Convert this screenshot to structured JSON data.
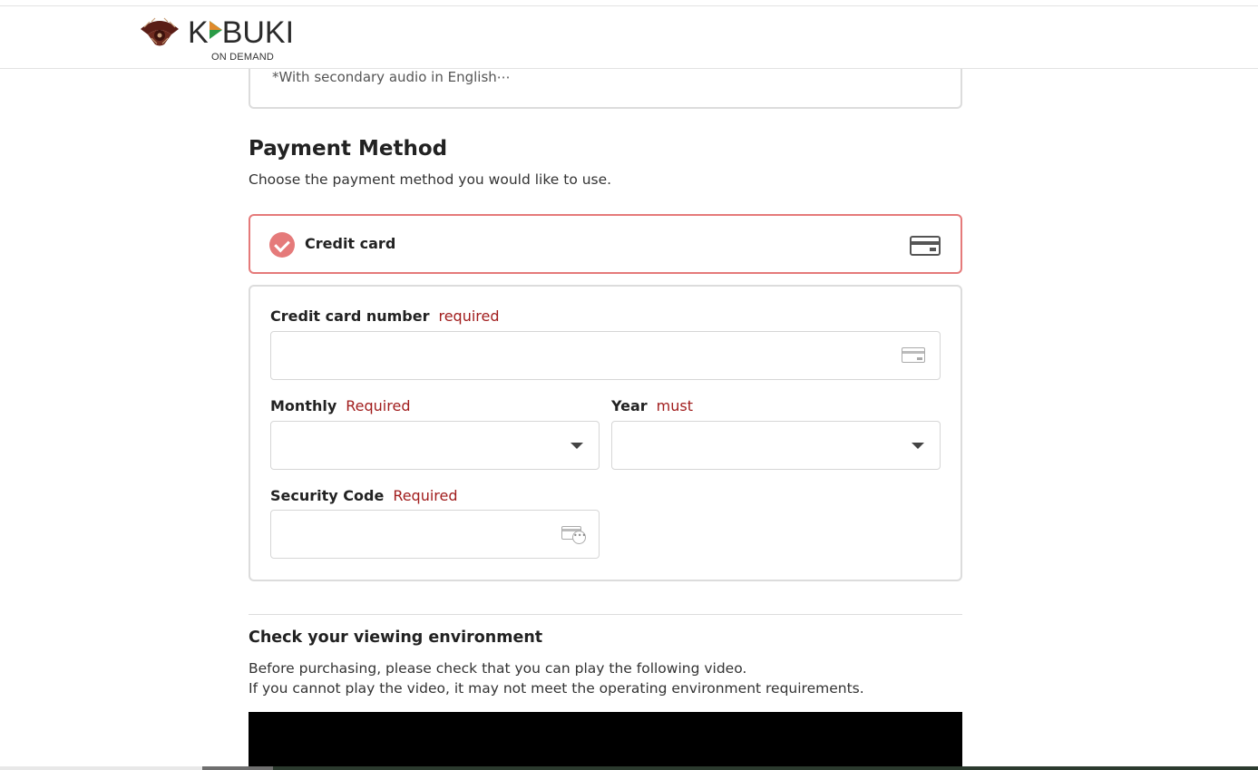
{
  "header": {
    "logo_text_1": "K",
    "logo_text_2": "BUKI",
    "logo_sub": "ON DEMAND"
  },
  "previous_section": {
    "note": "*With secondary audio in English⋯"
  },
  "payment": {
    "title": "Payment Method",
    "description": "Choose the payment method you would like to use.",
    "option_label": "Credit card",
    "accent_color": "#e57a7a"
  },
  "form": {
    "card_number_label": "Credit card number",
    "card_number_req": "required",
    "card_number_value": "",
    "month_label": "Monthly",
    "month_req": "Required",
    "month_value": "",
    "year_label": "Year",
    "year_req": "must",
    "year_value": "",
    "security_label": "Security Code",
    "security_req": "Required",
    "security_value": "",
    "required_color": "#a11d1d"
  },
  "environment": {
    "title": "Check your viewing environment",
    "line1": "Before purchasing, please check that you can play the following video.",
    "line2": "If you cannot play the video, it may not meet the operating environment requirements."
  }
}
